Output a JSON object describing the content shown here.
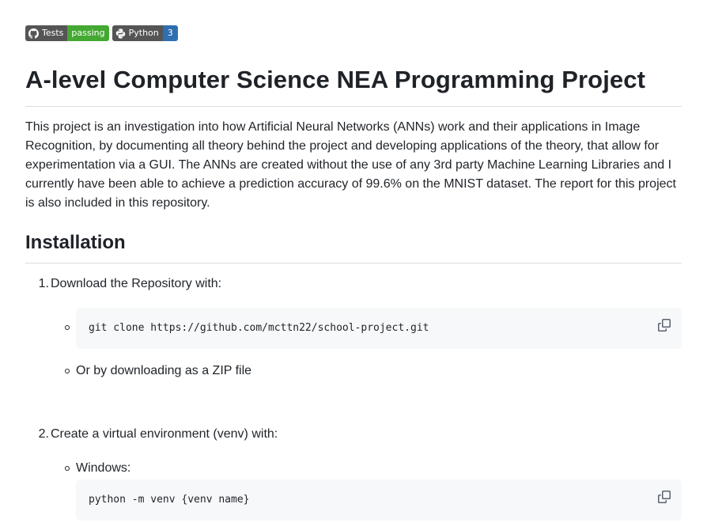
{
  "badges": {
    "tests": {
      "label": "Tests",
      "status": "passing",
      "icon": "github-icon",
      "color": "#44a832"
    },
    "python": {
      "label": "Python",
      "version": "3",
      "icon": "python-icon",
      "color": "#2f6fb0"
    }
  },
  "readme": {
    "title": "A-level Computer Science NEA Programming Project",
    "intro": "This project is an investigation into how Artificial Neural Networks (ANNs) work and their applications in Image Recognition, by documenting all theory behind the project and developing applications of the theory, that allow for experimentation via a GUI. The ANNs are created without the use of any 3rd party Machine Learning Libraries and I currently have been able to achieve a prediction accuracy of 99.6% on the MNIST dataset. The report for this project is also included in this repository.",
    "installation": {
      "heading": "Installation",
      "steps": [
        {
          "number": "1.",
          "text": "Download the Repository with:",
          "code": "git clone https://github.com/mcttn22/school-project.git",
          "alt": "Or by downloading as a ZIP file"
        },
        {
          "number": "2.",
          "text": "Create a virtual environment (venv) with:",
          "sub_label": "Windows:",
          "code": "python -m venv {venv name}"
        }
      ]
    }
  },
  "icons": {
    "copy": "copy-icon"
  }
}
